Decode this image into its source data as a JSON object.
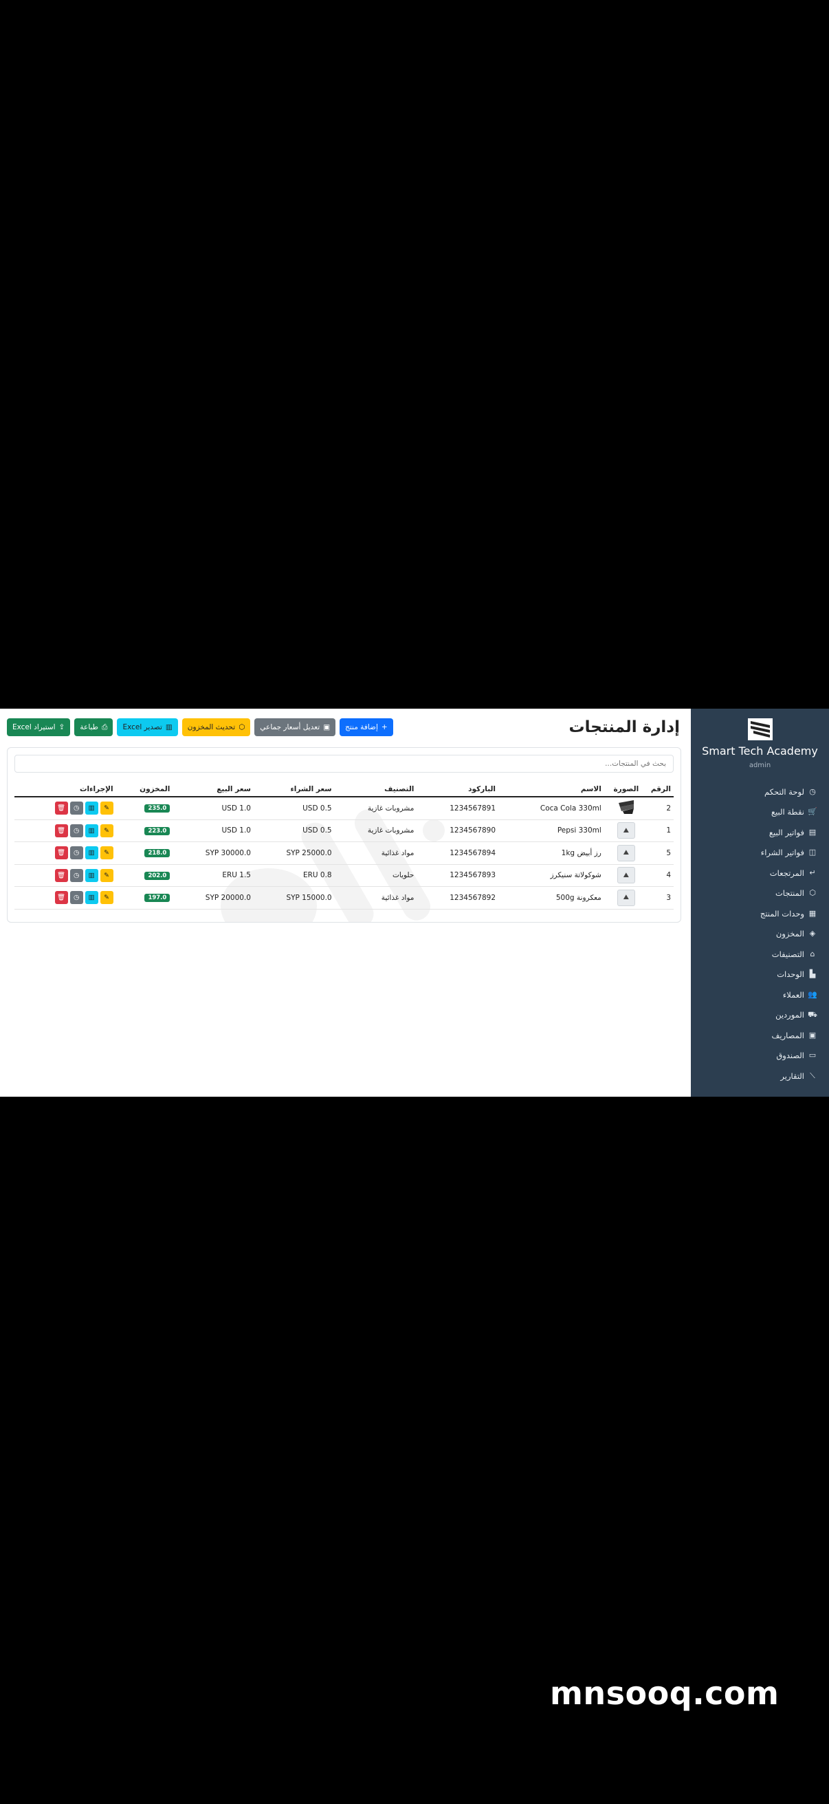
{
  "sidebar": {
    "brand": "Smart Tech Academy",
    "role": "admin",
    "items": [
      {
        "label": "لوحة التحكم",
        "icon": "speedometer-icon",
        "glyph": "◷"
      },
      {
        "label": "نقطة البيع",
        "icon": "cart-icon",
        "glyph": "🛒"
      },
      {
        "label": "فواتير البيع",
        "icon": "receipt-icon",
        "glyph": "▤"
      },
      {
        "label": "فواتير الشراء",
        "icon": "bag-icon",
        "glyph": "◫"
      },
      {
        "label": "المرتجعات",
        "icon": "return-arrow-icon",
        "glyph": "↵"
      },
      {
        "label": "المنتجات",
        "icon": "box-icon",
        "glyph": "⬡"
      },
      {
        "label": "وحدات المنتج",
        "icon": "boxes-icon",
        "glyph": "▦"
      },
      {
        "label": "المخزون",
        "icon": "warehouse-icon",
        "glyph": "◈"
      },
      {
        "label": "التصنيفات",
        "icon": "tags-icon",
        "glyph": "⌂"
      },
      {
        "label": "الوحدات",
        "icon": "units-icon",
        "glyph": "▙"
      },
      {
        "label": "العملاء",
        "icon": "people-icon",
        "glyph": "👥"
      },
      {
        "label": "الموردين",
        "icon": "truck-icon",
        "glyph": "⛟"
      },
      {
        "label": "المصاريف",
        "icon": "cash-icon",
        "glyph": "▣"
      },
      {
        "label": "الصندوق",
        "icon": "safe-icon",
        "glyph": "▭"
      },
      {
        "label": "التقارير",
        "icon": "graph-icon",
        "glyph": "⟋"
      }
    ]
  },
  "header": {
    "title": "إدارة المنتجات",
    "buttons": {
      "add": "إضافة منتج",
      "bulk_price": "تعديل أسعار جماعي",
      "update_stock": "تحديث المخزون",
      "export": "تصدير Excel",
      "print": "طباعة",
      "import": "استيراد Excel"
    }
  },
  "search": {
    "placeholder": "بحث في المنتجات..."
  },
  "table": {
    "columns": {
      "num": "الرقم",
      "image": "الصورة",
      "name": "الاسم",
      "barcode": "الباركود",
      "category": "التصنيف",
      "buy_price": "سعر الشراء",
      "sell_price": "سعر البيع",
      "stock": "المخزون",
      "actions": "الإجراءات"
    },
    "rows": [
      {
        "num": "2",
        "image": "product-photo",
        "name": "Coca Cola 330ml",
        "barcode": "1234567891",
        "category": "مشروبات غازية",
        "buy_price": "USD 0.5",
        "sell_price": "USD 1.0",
        "stock": "235.0"
      },
      {
        "num": "1",
        "image": "placeholder",
        "name": "Pepsi 330ml",
        "barcode": "1234567890",
        "category": "مشروبات غازية",
        "buy_price": "USD 0.5",
        "sell_price": "USD 1.0",
        "stock": "223.0"
      },
      {
        "num": "5",
        "image": "placeholder",
        "name": "رز أبيض 1kg",
        "barcode": "1234567894",
        "category": "مواد غذائية",
        "buy_price": "SYP 25000.0",
        "sell_price": "SYP 30000.0",
        "stock": "218.0"
      },
      {
        "num": "4",
        "image": "placeholder",
        "name": "شوكولاتة سنيكرز",
        "barcode": "1234567893",
        "category": "حلويات",
        "buy_price": "ERU 0.8",
        "sell_price": "ERU 1.5",
        "stock": "202.0"
      },
      {
        "num": "3",
        "image": "placeholder",
        "name": "معكرونة 500g",
        "barcode": "1234567892",
        "category": "مواد غذائية",
        "buy_price": "SYP 15000.0",
        "sell_price": "SYP 20000.0",
        "stock": "197.0"
      }
    ]
  },
  "footer": {
    "brand": "mnsooq.com"
  },
  "colors": {
    "sidebar": "#2c3e50",
    "primary": "#0d6efd",
    "secondary": "#6c757d",
    "warning": "#ffc107",
    "info": "#0dcaf0",
    "success": "#198754",
    "danger": "#dc3545"
  }
}
